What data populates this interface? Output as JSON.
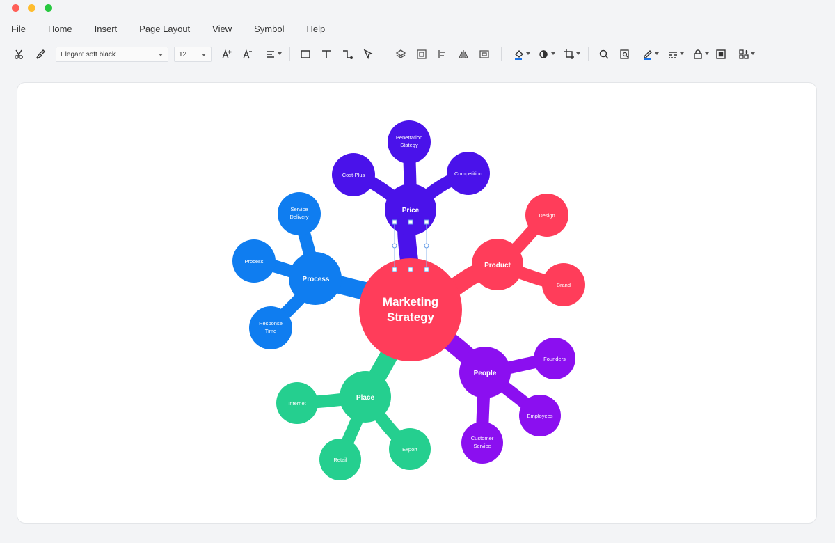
{
  "menu": [
    "File",
    "Home",
    "Insert",
    "Page Layout",
    "View",
    "Symbol",
    "Help"
  ],
  "toolbar": {
    "font_name": "Elegant soft black",
    "font_size": "12"
  },
  "colors": {
    "product": "#ff3d5a",
    "price": "#4a12ea",
    "process": "#0f7df0",
    "place": "#25cf8f",
    "people": "#8b0ff0",
    "center": "#ff3d5a",
    "accent_blue": "#1a73e8"
  },
  "mindmap": {
    "center": "Marketing Strategy",
    "branches": [
      {
        "key": "price",
        "label": "Price",
        "children": [
          "Penetration Stategy",
          "Cost-Plus",
          "Competition"
        ]
      },
      {
        "key": "product",
        "label": "Product",
        "children": [
          "Design",
          "Brand"
        ]
      },
      {
        "key": "process",
        "label": "Process",
        "children": [
          "Service Delivery",
          "Process",
          "Response Time"
        ]
      },
      {
        "key": "place",
        "label": "Place",
        "children": [
          "Internet",
          "Retail",
          "Export"
        ]
      },
      {
        "key": "people",
        "label": "People",
        "children": [
          "Founders",
          "Employees",
          "Customer Service"
        ]
      }
    ]
  }
}
